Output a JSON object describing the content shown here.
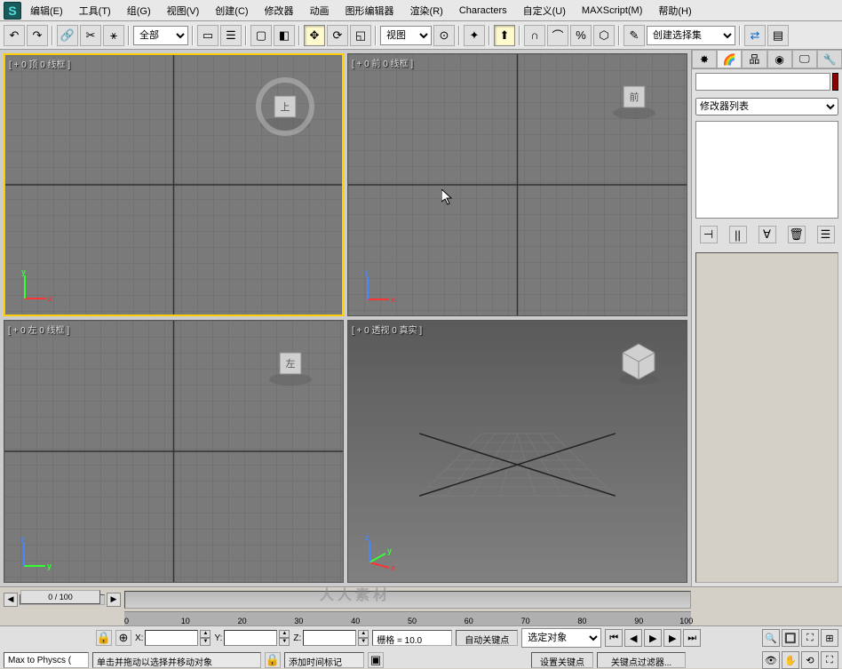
{
  "menus": {
    "edit": "编辑(E)",
    "tools": "工具(T)",
    "group": "组(G)",
    "views": "视图(V)",
    "create": "创建(C)",
    "modifiers": "修改器",
    "animation": "动画",
    "graph": "图形编辑器",
    "render": "渲染(R)",
    "characters": "Characters",
    "customize": "自定义(U)",
    "maxscript": "MAXScript(M)",
    "help": "帮助(H)"
  },
  "toolbar": {
    "filter_all": "全部",
    "ref_coord": "视图",
    "selection_set": "创建选择集"
  },
  "viewports": {
    "top": {
      "label": "[ + 0 顶 0 线框 ]",
      "cube": "上"
    },
    "front": {
      "label": "[ + 0 前 0 线框 ]",
      "cube": "前"
    },
    "left": {
      "label": "[ + 0 左 0 线框 ]",
      "cube": "左"
    },
    "persp": {
      "label": "[ + 0 透视 0 真实 ]"
    }
  },
  "panel": {
    "modifier_list": "修改器列表"
  },
  "timeline": {
    "frame": "0 / 100",
    "ticks": [
      "0",
      "10",
      "20",
      "30",
      "40",
      "50",
      "60",
      "70",
      "80",
      "90",
      "100"
    ]
  },
  "status": {
    "script": "Max to Physcs (",
    "hint": "单击并拖动以选择并移动对象",
    "add_time_tag": "添加时间标记",
    "lock_icon": "🔒",
    "x": "X:",
    "y": "Y:",
    "z": "Z:",
    "grid_label": "栅格 = 10.0",
    "auto_key": "自动关键点",
    "set_key": "设置关键点",
    "selected": "选定对象",
    "key_filter": "关键点过滤器..."
  },
  "watermark": "人人素材"
}
